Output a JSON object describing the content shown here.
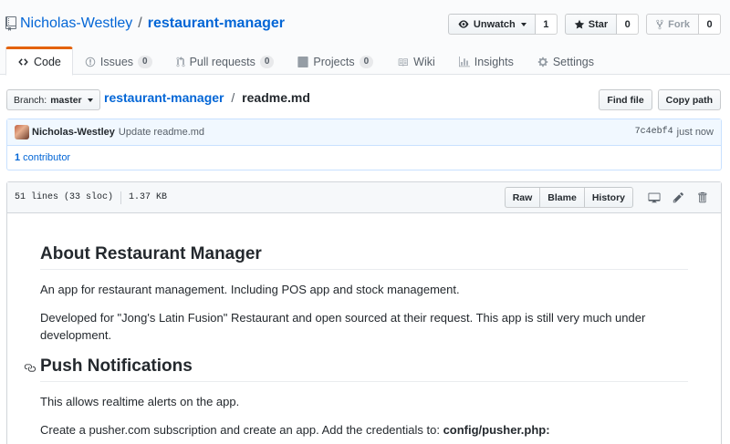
{
  "repo": {
    "owner": "Nicholas-Westley",
    "separator": "/",
    "name": "restaurant-manager"
  },
  "actions": {
    "watch_label": "Unwatch",
    "watch_count": "1",
    "star_label": "Star",
    "star_count": "0",
    "fork_label": "Fork",
    "fork_count": "0"
  },
  "tabs": [
    {
      "label": "Code",
      "icon": "code-icon",
      "selected": true
    },
    {
      "label": "Issues",
      "icon": "issue-icon",
      "count": "0"
    },
    {
      "label": "Pull requests",
      "icon": "pull-request-icon",
      "count": "0"
    },
    {
      "label": "Projects",
      "icon": "project-icon",
      "count": "0"
    },
    {
      "label": "Wiki",
      "icon": "book-icon"
    },
    {
      "label": "Insights",
      "icon": "graph-icon"
    },
    {
      "label": "Settings",
      "icon": "gear-icon"
    }
  ],
  "file_nav": {
    "branch_prefix": "Branch:",
    "branch": "master",
    "path_repo": "restaurant-manager",
    "path_sep": "/",
    "path_file": "readme.md",
    "find_file": "Find file",
    "copy_path": "Copy path"
  },
  "commit": {
    "author": "Nicholas-Westley",
    "message": "Update readme.md",
    "sha": "7c4ebf4",
    "time": "just now",
    "contributors_count": "1",
    "contributors_label": "contributor"
  },
  "file": {
    "lines": "51 lines (33 sloc)",
    "size": "1.37 KB",
    "raw": "Raw",
    "blame": "Blame",
    "history": "History"
  },
  "readme": {
    "h1": "About Restaurant Manager",
    "p1": "An app for restaurant management. Including POS app and stock management.",
    "p2": "Developed for \"Jong's Latin Fusion\" Restaurant and open sourced at their request. This app is still very much under development.",
    "h2": "Push Notifications",
    "p3": "This allows realtime alerts on the app.",
    "p4_text": "Create a pusher.com subscription and create an app. Add the credentials to: ",
    "p4_code": "config/pusher.php:"
  },
  "colors": {
    "link": "#0366d6",
    "tab_accent": "#e36209",
    "commit_bg": "#f1f8ff"
  }
}
